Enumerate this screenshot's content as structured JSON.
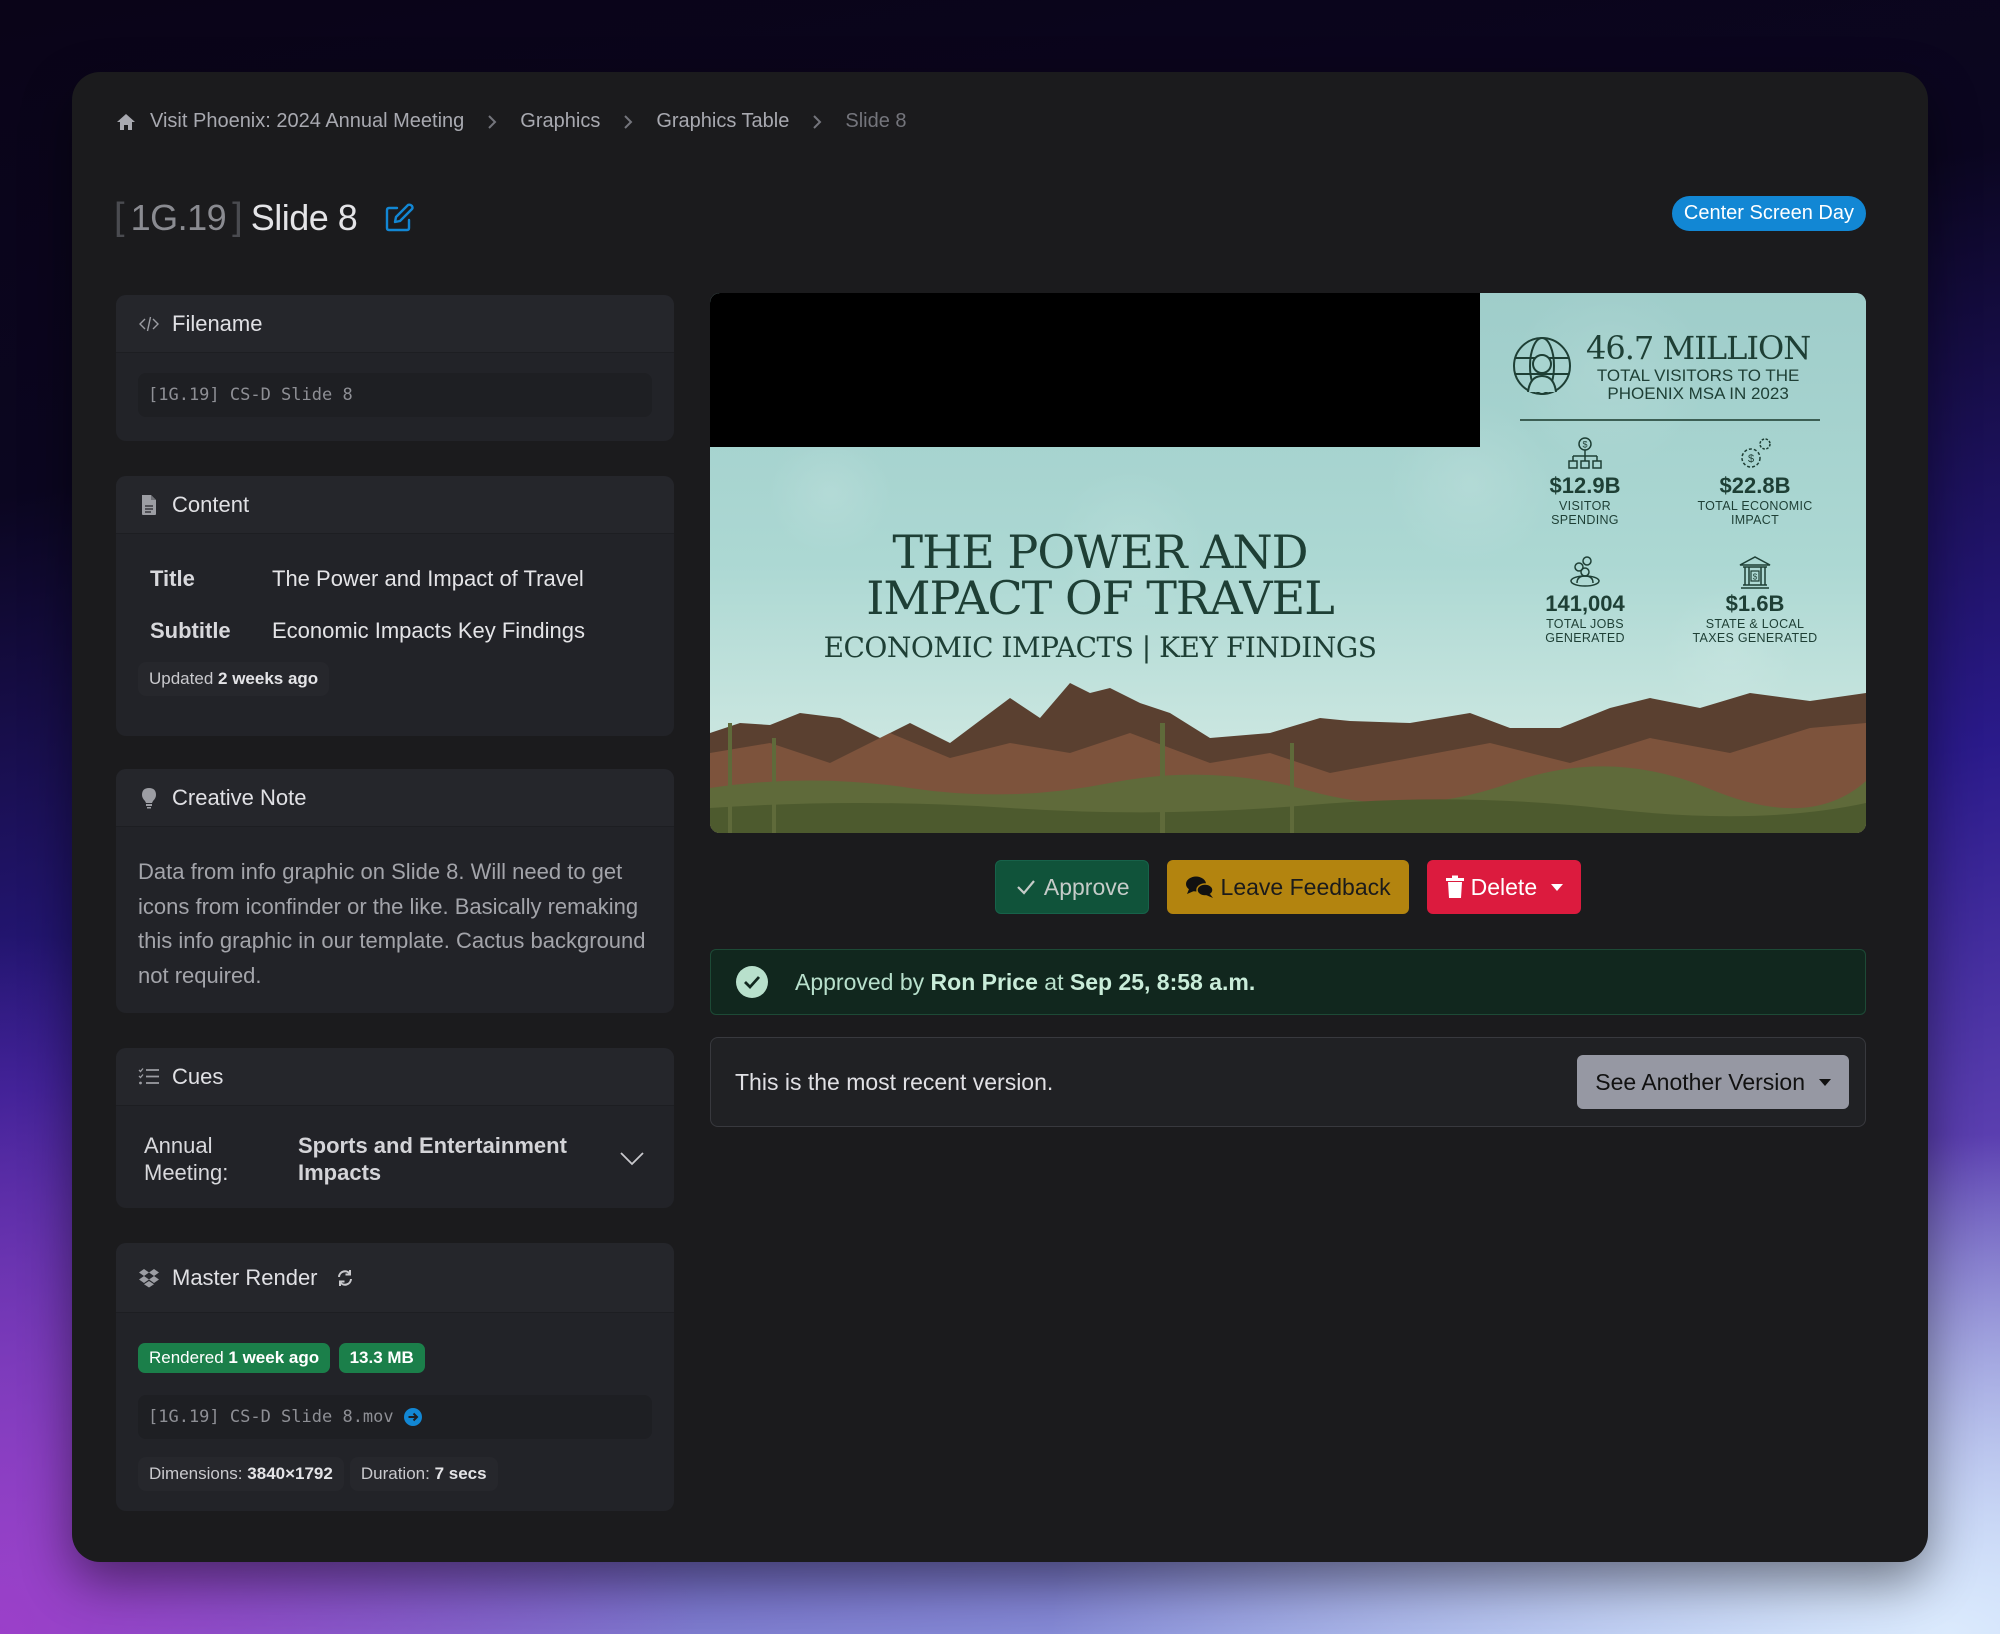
{
  "breadcrumb": {
    "items": [
      {
        "label": "Visit Phoenix: 2024 Annual Meeting"
      },
      {
        "label": "Graphics"
      },
      {
        "label": "Graphics Table"
      },
      {
        "label": "Slide 8"
      }
    ]
  },
  "header": {
    "code": "1G.19",
    "bracket_open": "[",
    "bracket_close": "]",
    "title": "Slide 8",
    "tag": "Center Screen Day"
  },
  "filename_card": {
    "heading": "Filename",
    "value": "[1G.19] CS-D Slide 8"
  },
  "content_card": {
    "heading": "Content",
    "fields": [
      {
        "key": "Title",
        "value": "The Power and Impact of Travel"
      },
      {
        "key": "Subtitle",
        "value": "Economic Impacts Key Findings"
      }
    ],
    "updated_prefix": "Updated",
    "updated_value": "2 weeks ago"
  },
  "creative_note_card": {
    "heading": "Creative Note",
    "text": "Data from info graphic on Slide 8. Will need to get icons from iconfinder or the like. Basically remaking this info graphic in our template. Cactus background not required."
  },
  "cues_card": {
    "heading": "Cues",
    "cue_key": "Annual Meeting:",
    "cue_value": "Sports and Entertainment Impacts"
  },
  "master_render_card": {
    "heading": "Master Render",
    "rendered_prefix": "Rendered",
    "rendered_value": "1 week ago",
    "file_size": "13.3 MB",
    "filename": "[1G.19] CS-D Slide 8.mov",
    "dimensions_label": "Dimensions:",
    "dimensions_value": "3840×1792",
    "duration_label": "Duration:",
    "duration_value": "7 secs"
  },
  "preview": {
    "title_line1": "THE POWER AND",
    "title_line2": "IMPACT OF TRAVEL",
    "subtitle": "ECONOMIC IMPACTS | KEY FINDINGS",
    "headline_value": "46.7 MILLION",
    "headline_caption_1": "TOTAL VISITORS TO THE",
    "headline_caption_2": "PHOENIX MSA IN 2023",
    "stats": [
      {
        "value": "$12.9B",
        "caption1": "VISITOR",
        "caption2": "SPENDING",
        "icon": "dollar-hierarchy-icon"
      },
      {
        "value": "$22.8B",
        "caption1": "TOTAL ECONOMIC",
        "caption2": "IMPACT",
        "icon": "dollar-gears-icon"
      },
      {
        "value": "141,004",
        "caption1": "TOTAL JOBS",
        "caption2": "GENERATED",
        "icon": "people-group-icon"
      },
      {
        "value": "$1.6B",
        "caption1": "STATE & LOCAL",
        "caption2": "TAXES GENERATED",
        "icon": "bank-icon"
      }
    ]
  },
  "actions": {
    "approve": "Approve",
    "feedback": "Leave Feedback",
    "delete": "Delete"
  },
  "approval": {
    "prefix": "Approved by",
    "user": "Ron Price",
    "mid": "at",
    "timestamp": "Sep 25, 8:58 a.m."
  },
  "version": {
    "text": "This is the most recent version.",
    "button": "See Another Version"
  },
  "colors": {
    "accent_blue": "#1287d4",
    "approve_green": "#10533a",
    "feedback_yellow": "#b3840f",
    "delete_red": "#dc1b3e",
    "render_badge_green": "#1b7f4a"
  }
}
